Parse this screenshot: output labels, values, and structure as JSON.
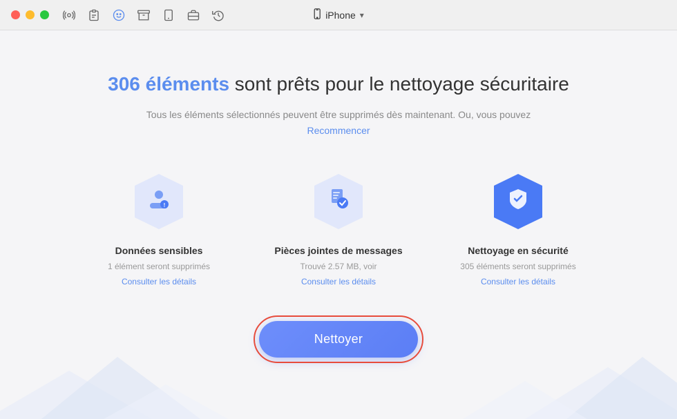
{
  "titlebar": {
    "device_name": "iPhone",
    "chevron": "▾",
    "icons": [
      "podcast",
      "clipboard",
      "clock-rotate",
      "face",
      "archive",
      "tablet",
      "briefcase",
      "history"
    ]
  },
  "headline": {
    "count": "306 éléments",
    "rest": " sont prêts pour le nettoyage sécuritaire"
  },
  "subtitle": {
    "line1": "Tous les éléments sélectionnés peuvent être supprimés dès maintenant. Ou, vous pouvez",
    "link": "Recommencer"
  },
  "cards": [
    {
      "id": "sensitive-data",
      "title": "Données sensibles",
      "desc": "1 élément seront supprimés",
      "link": "Consulter les détails",
      "icon_color": "#c5cef5",
      "icon_type": "person"
    },
    {
      "id": "message-attachments",
      "title": "Pièces jointes de messages",
      "desc": "Trouvé 2.57 MB, voir",
      "link": "Consulter les détails",
      "icon_color": "#c5cef5",
      "icon_type": "document"
    },
    {
      "id": "security-clean",
      "title": "Nettoyage en sécurité",
      "desc": "305 éléments seront supprimés",
      "link": "Consulter les détails",
      "icon_color": "#3b6de8",
      "icon_type": "shield"
    }
  ],
  "clean_button": {
    "label": "Nettoyer"
  }
}
